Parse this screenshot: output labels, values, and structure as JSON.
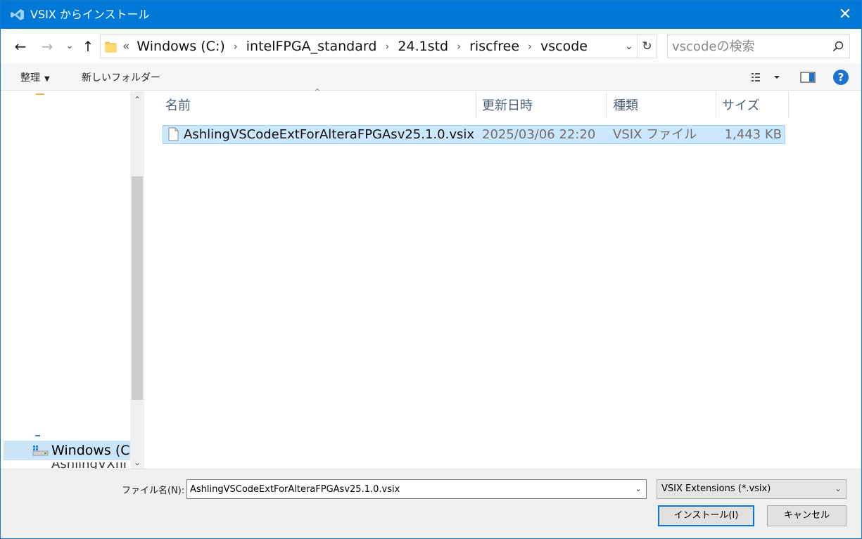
{
  "window": {
    "title": "VSIX からインストール",
    "close_glyph": "✕"
  },
  "nav": {
    "back_glyph": "←",
    "forward_glyph": "→",
    "recent_glyph": "⌄",
    "up_glyph": "↑",
    "overflow_glyph": "«",
    "separator_glyph": "›",
    "breadcrumbs": [
      "Windows (C:)",
      "intelFPGA_standard",
      "24.1std",
      "riscfree",
      "vscode"
    ],
    "dropdown_glyph": "⌄",
    "refresh_glyph": "↻"
  },
  "search": {
    "placeholder": "vscodeの検索"
  },
  "toolbar": {
    "organize_label": "整理",
    "organize_caret": "▼",
    "new_folder_label": "新しいフォルダー",
    "help_label": "?"
  },
  "sidebar": {
    "drive_label": "Windows (C:)",
    "partial_label": "AshlingVXfil",
    "scroll_up_glyph": "⌃",
    "scroll_down_glyph": "⌄"
  },
  "list": {
    "sort_glyph": "^",
    "columns": {
      "name": "名前",
      "date": "更新日時",
      "type": "種類",
      "size": "サイズ"
    },
    "rows": [
      {
        "name": "AshlingVSCodeExtForAlteraFPGAsv25.1.0.vsix",
        "date": "2025/03/06 22:20",
        "type": "VSIX ファイル",
        "size": "1,443 KB"
      }
    ]
  },
  "footer": {
    "filename_label": "ファイル名(N):",
    "filename_value": "AshlingVSCodeExtForAlteraFPGAsv25.1.0.vsix",
    "dropdown_glyph": "⌄",
    "filter_value": "VSIX Extensions (*.vsix)",
    "install_label": "インストール(I)",
    "cancel_label": "キャンセル"
  },
  "colors": {
    "titlebar": "#0078d7",
    "selection": "#cce8ff",
    "selection_border": "#99d1ff",
    "help": "#1c73cf"
  }
}
